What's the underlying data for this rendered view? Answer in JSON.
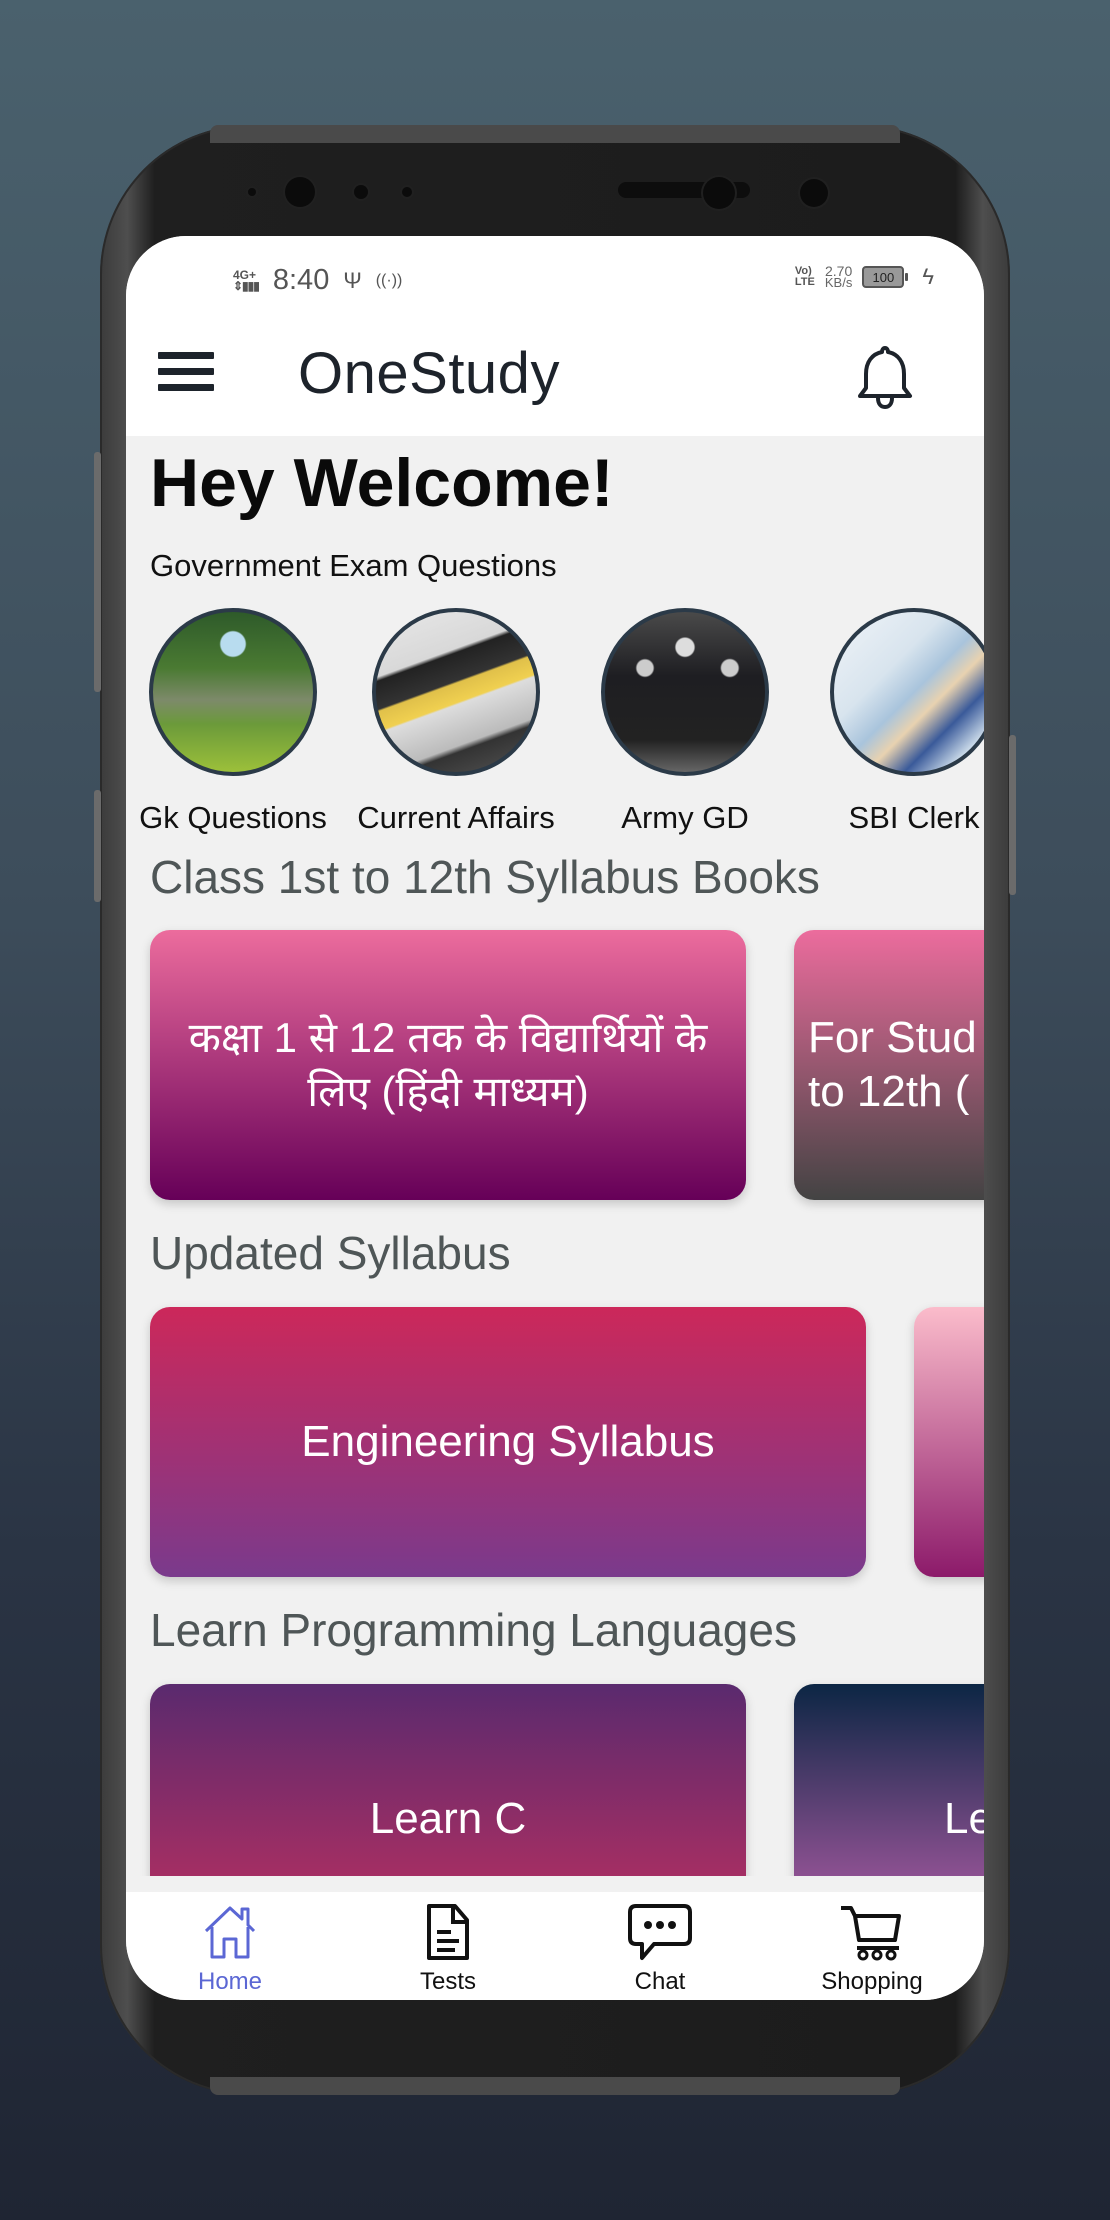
{
  "status_bar": {
    "network": "4G+",
    "time": "8:40",
    "volte": "Vo LTE",
    "speed_value": "2.70",
    "speed_unit": "KB/s",
    "battery": "100"
  },
  "app_bar": {
    "title": "OneStudy",
    "menu_icon": "hamburger-menu-icon",
    "notification_icon": "bell-icon"
  },
  "welcome": {
    "heading": "Hey Welcome!",
    "subheading": "Government Exam Questions"
  },
  "exam_categories": [
    {
      "label": "Gk Questions",
      "image": "park-trees-photo"
    },
    {
      "label": "Current Affairs",
      "image": "newspaper-photo"
    },
    {
      "label": "Army GD",
      "image": "soldiers-parade-photo"
    },
    {
      "label": "SBI Clerk",
      "image": "bank-counter-photo"
    }
  ],
  "sections": [
    {
      "title": "Class 1st to 12th Syllabus Books",
      "cards": [
        {
          "label": "कक्षा 1 से 12 तक के विद्यार्थियों के\nलिए (हिंदी माध्यम)",
          "gradient": [
            "#ec6c9d",
            "#660058"
          ]
        },
        {
          "label": "For Stud\nto 12th (",
          "gradient": [
            "#ec6c9d",
            "#434343"
          ]
        }
      ]
    },
    {
      "title": "Updated Syllabus",
      "cards": [
        {
          "label": "Engineering Syllabus",
          "gradient": [
            "#cc285a",
            "#7a3a8c"
          ]
        },
        {
          "label": "",
          "gradient": [
            "#fbbccb",
            "#8c1a6a"
          ]
        }
      ]
    },
    {
      "title": "Learn Programming Languages",
      "cards": [
        {
          "label": "Learn C",
          "gradient": [
            "#5a2a6e",
            "#c2305f"
          ]
        },
        {
          "label": "Le",
          "gradient": [
            "#0c2644",
            "#c062b0"
          ]
        }
      ]
    }
  ],
  "bottom_nav": [
    {
      "label": "Home",
      "icon": "home-icon",
      "active": true
    },
    {
      "label": "Tests",
      "icon": "document-icon",
      "active": false
    },
    {
      "label": "Chat",
      "icon": "chat-bubble-icon",
      "active": false
    },
    {
      "label": "Shopping",
      "icon": "shopping-cart-icon",
      "active": false
    }
  ],
  "colors": {
    "accent": "#5b67d4",
    "title_text": "#1d232b",
    "section_title": "#4f5657",
    "content_bg": "#f1f1f1"
  }
}
